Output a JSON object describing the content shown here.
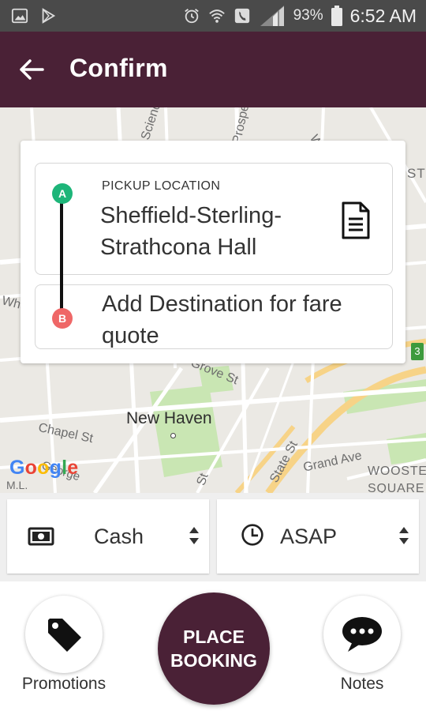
{
  "status_bar": {
    "battery_percent": "93%",
    "time": "6:52 AM",
    "icons": [
      "image-icon",
      "play-store-icon",
      "alarm-icon",
      "wifi-icon",
      "phone-icon",
      "signal-icon",
      "battery-icon"
    ]
  },
  "app_bar": {
    "title": "Confirm",
    "back_icon": "arrow-left-icon"
  },
  "map": {
    "city_label": "New Haven",
    "street_labels": [
      "Science",
      "Prospect St",
      "Whitney",
      "Grove St",
      "Chapel St",
      "State St",
      "Grand Ave",
      "WOOSTER SQUARE",
      "St",
      "M.L.",
      "George",
      "Wha",
      "ST"
    ],
    "route_shield": "3",
    "attribution": "Google",
    "attribution_colors": [
      "#4285f4",
      "#ea4335",
      "#fbbc05",
      "#4285f4",
      "#34a853",
      "#ea4335"
    ]
  },
  "locations": {
    "pickup_label": "PICKUP LOCATION",
    "pickup_value": "Sheffield-Sterling-Strathcona Hall",
    "pickup_marker": "A",
    "destination_placeholder": "Add Destination for fare quote",
    "destination_marker": "B",
    "notes_icon": "document-icon"
  },
  "selectors": {
    "payment": {
      "value": "Cash",
      "icon": "cash-icon"
    },
    "time": {
      "value": "ASAP",
      "icon": "clock-icon"
    }
  },
  "actions": {
    "promotions_label": "Promotions",
    "promotions_icon": "tag-icon",
    "place_booking_label": "PLACE BOOKING",
    "notes_label": "Notes",
    "notes_icon": "chat-bubble-icon"
  },
  "colors": {
    "brand": "#4a2136",
    "marker_a": "#1db579",
    "marker_b": "#ef6767"
  }
}
